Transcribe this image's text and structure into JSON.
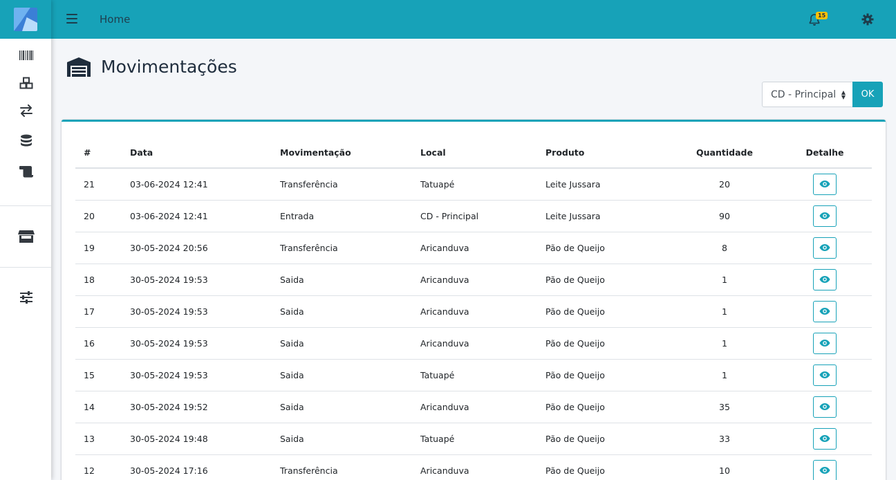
{
  "colors": {
    "primary": "#17a2b8",
    "warning": "#ffc107",
    "sidebar_bg": "#ffffff",
    "content_bg": "#f4f6f9"
  },
  "sidebar": {
    "items": [
      {
        "icon": "barcode-icon"
      },
      {
        "icon": "boxes-icon"
      },
      {
        "icon": "exchange-icon"
      },
      {
        "icon": "database-icon"
      },
      {
        "icon": "scroll-icon"
      },
      {
        "icon": "store-icon"
      },
      {
        "icon": "sliders-icon"
      }
    ]
  },
  "topbar": {
    "breadcrumb": "Home",
    "notifications_count": "15"
  },
  "page": {
    "title": "Movimentações"
  },
  "filter": {
    "selected": "CD - Principal",
    "ok_label": "OK"
  },
  "table": {
    "headers": [
      "#",
      "Data",
      "Movimentação",
      "Local",
      "Produto",
      "Quantidade",
      "Detalhe"
    ],
    "rows": [
      [
        "21",
        "03-06-2024 12:41",
        "Transferência",
        "Tatuapé",
        "Leite Jussara",
        "20"
      ],
      [
        "20",
        "03-06-2024 12:41",
        "Entrada",
        "CD - Principal",
        "Leite Jussara",
        "90"
      ],
      [
        "19",
        "30-05-2024 20:56",
        "Transferência",
        "Aricanduva",
        "Pão de Queijo",
        "8"
      ],
      [
        "18",
        "30-05-2024 19:53",
        "Saida",
        "Aricanduva",
        "Pão de Queijo",
        "1"
      ],
      [
        "17",
        "30-05-2024 19:53",
        "Saida",
        "Aricanduva",
        "Pão de Queijo",
        "1"
      ],
      [
        "16",
        "30-05-2024 19:53",
        "Saida",
        "Aricanduva",
        "Pão de Queijo",
        "1"
      ],
      [
        "15",
        "30-05-2024 19:53",
        "Saida",
        "Tatuapé",
        "Pão de Queijo",
        "1"
      ],
      [
        "14",
        "30-05-2024 19:52",
        "Saida",
        "Aricanduva",
        "Pão de Queijo",
        "35"
      ],
      [
        "13",
        "30-05-2024 19:48",
        "Saida",
        "Tatuapé",
        "Pão de Queijo",
        "33"
      ],
      [
        "12",
        "30-05-2024 17:16",
        "Transferência",
        "Aricanduva",
        "Pão de Queijo",
        "10"
      ]
    ]
  }
}
